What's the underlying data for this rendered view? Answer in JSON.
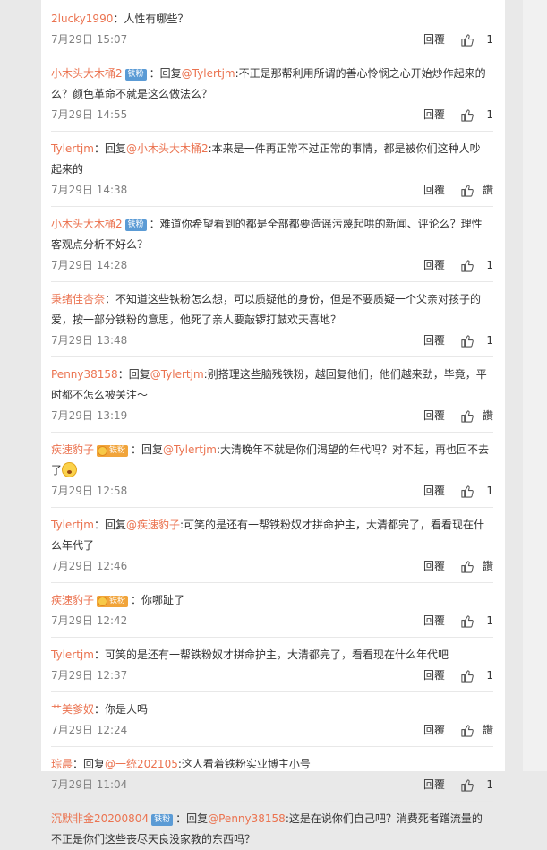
{
  "comments": [
    {
      "segments": [
        {
          "t": "user",
          "v": "2lucky1990"
        },
        {
          "t": "text",
          "v": "：人性有哪些？"
        }
      ],
      "time": "7月29日 15:07",
      "reply": "回覆",
      "likes": "1"
    },
    {
      "segments": [
        {
          "t": "user",
          "v": "小木头大木桶2"
        },
        {
          "t": "badge",
          "v": "铁粉"
        },
        {
          "t": "text",
          "v": "：回复"
        },
        {
          "t": "mention",
          "v": "@Tylertjm"
        },
        {
          "t": "text",
          "v": ":不正是那帮利用所谓的善心怜悯之心开始炒作起来的么？颜色革命不就是这么做法么？"
        }
      ],
      "time": "7月29日 14:55",
      "reply": "回覆",
      "likes": "1"
    },
    {
      "segments": [
        {
          "t": "user",
          "v": "Tylertjm"
        },
        {
          "t": "text",
          "v": "：回复"
        },
        {
          "t": "mention",
          "v": "@小木头大木桶2"
        },
        {
          "t": "text",
          "v": ":本来是一件再正常不过正常的事情，都是被你们这种人吵起来的"
        }
      ],
      "time": "7月29日 14:38",
      "reply": "回覆",
      "likes": "讚"
    },
    {
      "segments": [
        {
          "t": "user",
          "v": "小木头大木桶2"
        },
        {
          "t": "badge",
          "v": "铁粉"
        },
        {
          "t": "text",
          "v": "：难道你希望看到的都是全部都要造谣污蔑起哄的新闻、评论么？理性客观点分析不好么？"
        }
      ],
      "time": "7月29日 14:28",
      "reply": "回覆",
      "likes": "1"
    },
    {
      "segments": [
        {
          "t": "user",
          "v": "秉绪佳杏奈"
        },
        {
          "t": "text",
          "v": "：不知道这些铁粉怎么想，可以质疑他的身份，但是不要质疑一个父亲对孩子的爱，按一部分铁粉的意思，他死了亲人要敲锣打鼓欢天喜地？"
        }
      ],
      "time": "7月29日 13:48",
      "reply": "回覆",
      "likes": "1"
    },
    {
      "segments": [
        {
          "t": "user",
          "v": "Penny38158"
        },
        {
          "t": "text",
          "v": "：回复"
        },
        {
          "t": "mention",
          "v": "@Tylertjm"
        },
        {
          "t": "text",
          "v": ":别搭理这些脑残铁粉，越回复他们，他们越来劲，毕竟，平时都不怎么被关注～"
        }
      ],
      "time": "7月29日 13:19",
      "reply": "回覆",
      "likes": "讚"
    },
    {
      "segments": [
        {
          "t": "user",
          "v": "疾速豹子"
        },
        {
          "t": "goldbadge",
          "v": "铁粉"
        },
        {
          "t": "text",
          "v": "：回复"
        },
        {
          "t": "mention",
          "v": "@Tylertjm"
        },
        {
          "t": "text",
          "v": ":大清晚年不就是你们渴望的年代吗？对不起，再也回不去了"
        },
        {
          "t": "emoji",
          "v": ""
        }
      ],
      "time": "7月29日 12:58",
      "reply": "回覆",
      "likes": "1"
    },
    {
      "segments": [
        {
          "t": "user",
          "v": "Tylertjm"
        },
        {
          "t": "text",
          "v": "：回复"
        },
        {
          "t": "mention",
          "v": "@疾速豹子"
        },
        {
          "t": "text",
          "v": ":可笑的是还有一帮铁粉奴才拼命护主，大清都完了，看看现在什么年代了"
        }
      ],
      "time": "7月29日 12:46",
      "reply": "回覆",
      "likes": "讚"
    },
    {
      "segments": [
        {
          "t": "user",
          "v": "疾速豹子"
        },
        {
          "t": "goldbadge",
          "v": "铁粉"
        },
        {
          "t": "text",
          "v": "：你哪趾了"
        }
      ],
      "time": "7月29日 12:42",
      "reply": "回覆",
      "likes": "1"
    },
    {
      "segments": [
        {
          "t": "user",
          "v": "Tylertjm"
        },
        {
          "t": "text",
          "v": "：可笑的是还有一帮铁粉奴才拼命护主，大清都完了，看看现在什么年代吧"
        }
      ],
      "time": "7月29日 12:37",
      "reply": "回覆",
      "likes": "1"
    },
    {
      "segments": [
        {
          "t": "user",
          "v": "艹美爹奴"
        },
        {
          "t": "text",
          "v": "：你是人吗"
        }
      ],
      "time": "7月29日 12:24",
      "reply": "回覆",
      "likes": "讚"
    },
    {
      "segments": [
        {
          "t": "user",
          "v": "琮晨"
        },
        {
          "t": "text",
          "v": "：回复"
        },
        {
          "t": "mention",
          "v": "@一统202105"
        },
        {
          "t": "text",
          "v": ":这人看着铁粉实业博主小号"
        }
      ],
      "time": "7月29日 11:04",
      "reply": "回覆",
      "likes": "1"
    },
    {
      "segments": [
        {
          "t": "user",
          "v": "沉默非金20200804"
        },
        {
          "t": "badge",
          "v": "铁粉"
        },
        {
          "t": "text",
          "v": "：回复"
        },
        {
          "t": "mention",
          "v": "@Penny38158"
        },
        {
          "t": "text",
          "v": ":这是在说你们自己吧？消费死者蹭流量的不正是你们这些丧尽天良没家教的东西吗？"
        }
      ],
      "time": "",
      "reply": "",
      "likes": ""
    }
  ]
}
